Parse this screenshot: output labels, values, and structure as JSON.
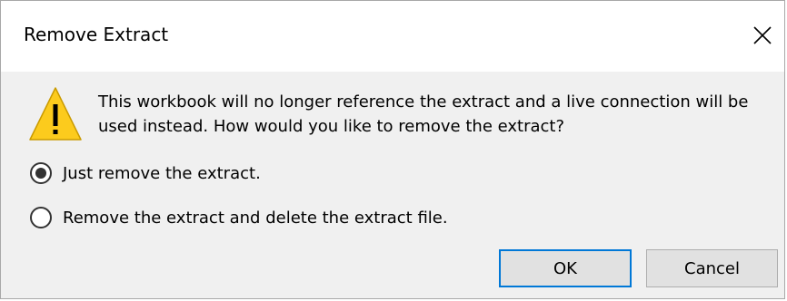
{
  "dialog": {
    "title": "Remove Extract",
    "message": "This workbook will no longer reference the extract and a live connection will be used instead. How would you like to remove the extract?",
    "options": [
      {
        "label": "Just remove the extract.",
        "selected": true
      },
      {
        "label": "Remove the extract and delete the extract file.",
        "selected": false
      }
    ],
    "ok_label": "OK",
    "cancel_label": "Cancel"
  },
  "icons": {
    "close": "close-icon",
    "warning": "warning-icon"
  },
  "colors": {
    "warning_fill": "#fccb1d",
    "focus_border": "#0078d7",
    "dialog_bg": "#f0f0f0"
  }
}
